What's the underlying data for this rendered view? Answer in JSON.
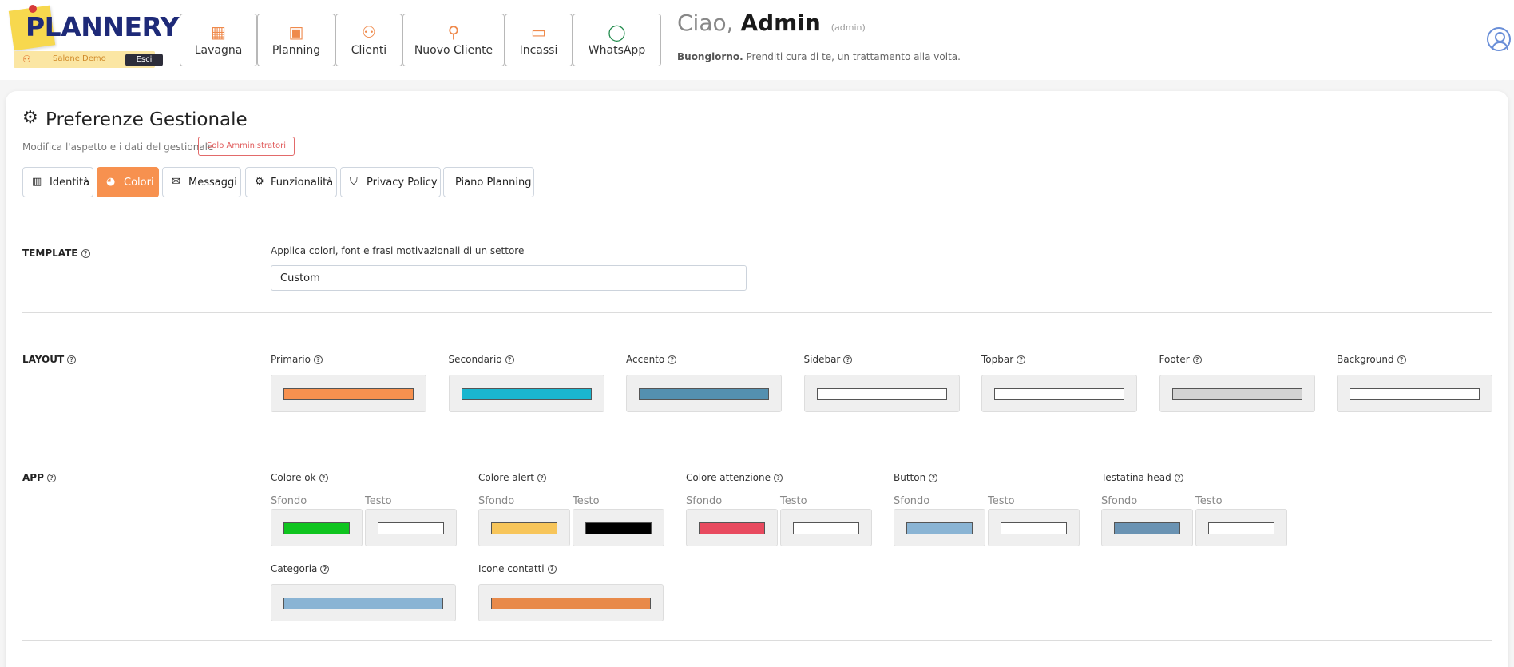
{
  "header": {
    "logo_text": "PLANNERY",
    "salon_name": "Salone Demo",
    "exit_label": "Esci",
    "nav": [
      {
        "label": "Lavagna",
        "icon": "dashboard-icon"
      },
      {
        "label": "Planning",
        "icon": "calendar-clock-icon"
      },
      {
        "label": "Clienti",
        "icon": "users-icon"
      },
      {
        "label": "Nuovo Cliente",
        "icon": "user-plus-icon"
      },
      {
        "label": "Incassi",
        "icon": "cash-icon"
      },
      {
        "label": "WhatsApp",
        "icon": "whatsapp-icon"
      }
    ],
    "greeting_prefix": "Ciao,",
    "user_name": "Admin",
    "user_role": "(admin)",
    "motto_bold": "Buongiorno.",
    "motto_text": "Prenditi cura di te, un trattamento alla volta."
  },
  "page": {
    "title": "Preferenze Gestionale",
    "subtitle": "Modifica l'aspetto e i dati del gestionale",
    "admin_badge": "Solo Amministratori",
    "tabs": [
      {
        "label": "Identità",
        "icon": "building-icon",
        "active": false
      },
      {
        "label": "Colori",
        "icon": "palette-icon",
        "active": true
      },
      {
        "label": "Messaggi",
        "icon": "envelope-icon",
        "active": false
      },
      {
        "label": "Funzionalità",
        "icon": "gear-icon",
        "active": false
      },
      {
        "label": "Privacy Policy",
        "icon": "shield-user-icon",
        "active": false
      },
      {
        "label": "Piano Planning",
        "icon": "",
        "active": false
      }
    ]
  },
  "template": {
    "label": "TEMPLATE",
    "hint": "Applica colori, font e frasi motivazionali di un settore",
    "value": "Custom"
  },
  "layout": {
    "label": "LAYOUT",
    "colors": [
      {
        "label": "Primario",
        "color": "#f7914f"
      },
      {
        "label": "Secondario",
        "color": "#1ab6cf"
      },
      {
        "label": "Accento",
        "color": "#5490b0"
      },
      {
        "label": "Sidebar",
        "color": "#ffffff"
      },
      {
        "label": "Topbar",
        "color": "#ffffff"
      },
      {
        "label": "Footer",
        "color": "#d3d3d3"
      },
      {
        "label": "Background",
        "color": "#ffffff"
      }
    ]
  },
  "app": {
    "label": "APP",
    "bg_label": "Sfondo",
    "text_label": "Testo",
    "pairs": [
      {
        "label": "Colore ok",
        "bg": "#0fc41f",
        "text": "#ffffff"
      },
      {
        "label": "Colore alert",
        "bg": "#f7c55a",
        "text": "#000000"
      },
      {
        "label": "Colore attenzione",
        "bg": "#e84a5f",
        "text": "#ffffff"
      },
      {
        "label": "Button",
        "bg": "#8ab4d4",
        "text": "#ffffff"
      },
      {
        "label": "Testatina head",
        "bg": "#6a93b3",
        "text": "#ffffff"
      }
    ],
    "singles": [
      {
        "label": "Categoria",
        "color": "#8ab4d4"
      },
      {
        "label": "Icone contatti",
        "color": "#e88a4a"
      }
    ]
  }
}
